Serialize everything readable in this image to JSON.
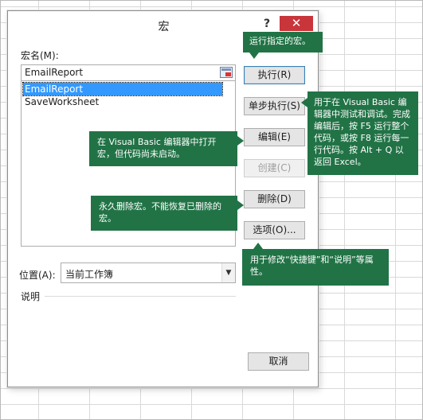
{
  "dialog": {
    "title": "宏",
    "help": "?",
    "close": "✕"
  },
  "macro_name": {
    "label": "宏名(M):",
    "value": "EmailReport"
  },
  "macro_list": {
    "items": [
      "EmailReport",
      "SaveWorksheet"
    ],
    "selected_index": 0
  },
  "location": {
    "label": "位置(A):",
    "value": "当前工作簿",
    "arrow": "▼"
  },
  "description": {
    "label": "说明"
  },
  "buttons": {
    "run": "执行(R)",
    "step_into": "单步执行(S)",
    "edit": "编辑(E)",
    "create": "创建(C)",
    "delete": "删除(D)",
    "options": "选项(O)...",
    "cancel": "取消"
  },
  "callouts": {
    "run": "运行指定的宏。",
    "step_into": "用于在 Visual Basic 编辑器中测试和调试。完成编辑后，按 F5 运行整个代码，或按 F8 运行每一行代码。按 Alt + Q 以返回 Excel。",
    "edit": "在 Visual Basic 编辑器中打开宏，但代码尚未启动。",
    "delete": "永久删除宏。不能恢复已删除的宏。",
    "options": "用于修改“快捷键”和“说明”等属性。"
  },
  "colors": {
    "callout_green": "#217346",
    "close_red": "#c8353a",
    "selection_blue": "#3399ff"
  }
}
